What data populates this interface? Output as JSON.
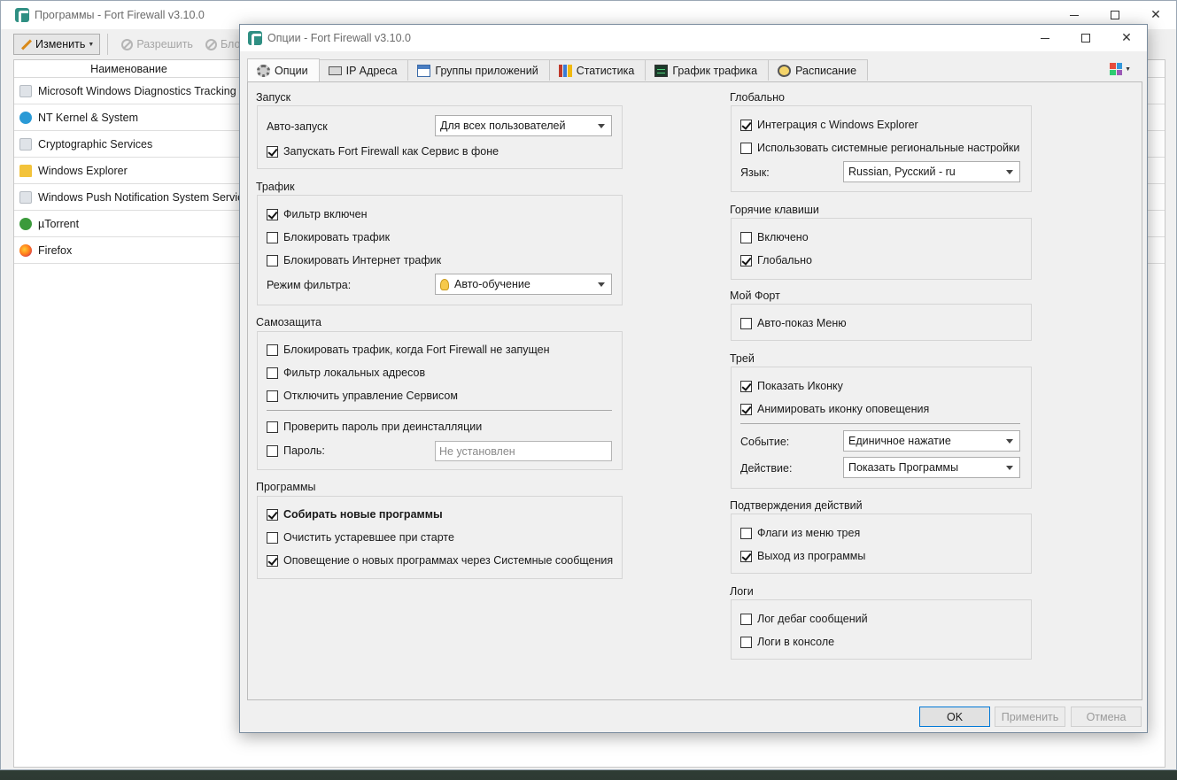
{
  "bg_window": {
    "title": "Программы - Fort Firewall v3.10.0",
    "toolbar": {
      "edit_label": "Изменить",
      "allow_label": "Разрешить",
      "block_label": "Блоки"
    },
    "list_header": "Наименование",
    "programs": [
      {
        "name": "Microsoft Windows Diagnostics Tracking",
        "icon": "generic-icon"
      },
      {
        "name": "NT Kernel & System",
        "icon": "windows-icon"
      },
      {
        "name": "Cryptographic Services",
        "icon": "generic-icon"
      },
      {
        "name": "Windows Explorer",
        "icon": "folder-icon"
      },
      {
        "name": "Windows Push Notification System Service",
        "icon": "generic-icon"
      },
      {
        "name": "µTorrent",
        "icon": "utorrent-icon"
      },
      {
        "name": "Firefox",
        "icon": "firefox-icon"
      }
    ]
  },
  "dialog": {
    "title": "Опции - Fort Firewall v3.10.0",
    "tabs": [
      "Опции",
      "IP Адреса",
      "Группы приложений",
      "Статистика",
      "График трафика",
      "Расписание"
    ],
    "left": {
      "startup": {
        "title": "Запуск",
        "autostart_label": "Авто-запуск",
        "autostart_value": "Для всех пользователей",
        "service_label": "Запускать Fort Firewall как Сервис в фоне",
        "service_checked": true
      },
      "traffic": {
        "title": "Трафик",
        "filter_enabled": "Фильтр включен",
        "block_traffic": "Блокировать трафик",
        "block_internet": "Блокировать Интернет трафик",
        "filter_mode_label": "Режим фильтра:",
        "filter_mode_value": "Авто-обучение"
      },
      "protection": {
        "title": "Самозащита",
        "block_when_stopped": "Блокировать трафик, когда Fort Firewall не запущен",
        "filter_local": "Фильтр локальных адресов",
        "disable_service_control": "Отключить управление Сервисом",
        "check_password_uninstall": "Проверить пароль при деинсталляции",
        "password_label": "Пароль:",
        "password_placeholder": "Не установлен"
      },
      "programs": {
        "title": "Программы",
        "collect_new": "Собирать новые программы",
        "purge_on_start": "Очистить устаревшее при старте",
        "notify_new": "Оповещение о новых программах через Системные сообщения"
      }
    },
    "right": {
      "global": {
        "title": "Глобально",
        "explorer_integration": "Интеграция с Windows Explorer",
        "use_system_locale": "Использовать системные региональные настройки",
        "language_label": "Язык:",
        "language_value": "Russian, Русский - ru"
      },
      "hotkeys": {
        "title": "Горячие клавиши",
        "enabled": "Включено",
        "global": "Глобально"
      },
      "my_fort": {
        "title": "Мой Форт",
        "auto_menu": "Авто-показ Меню"
      },
      "tray": {
        "title": "Трей",
        "show_icon": "Показать Иконку",
        "animate_icon": "Анимировать иконку оповещения",
        "event_label": "Событие:",
        "event_value": "Единичное нажатие",
        "action_label": "Действие:",
        "action_value": "Показать Программы"
      },
      "confirmations": {
        "title": "Подтверждения действий",
        "tray_flags": "Флаги из меню трея",
        "exit_program": "Выход из программы"
      },
      "logs": {
        "title": "Логи",
        "debug_log": "Лог дебаг сообщений",
        "console_log": "Логи в консоле"
      }
    },
    "buttons": {
      "ok": "OK",
      "apply": "Применить",
      "cancel": "Отмена"
    }
  }
}
